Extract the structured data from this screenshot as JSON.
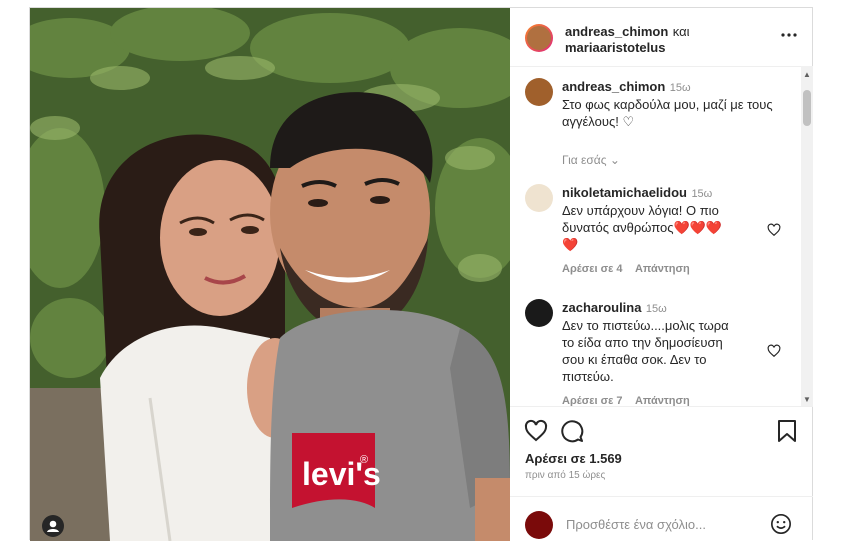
{
  "post": {
    "header": {
      "user1": "andreas_chimon",
      "and_word": "και",
      "user2": "mariaaristotelus"
    },
    "caption": {
      "user": "andreas_chimon",
      "time": "15ω",
      "text_line1": "Στο φως καρδούλα μου, μαζί με τους",
      "text_line2": "αγγέλους! ♡"
    },
    "for_you": "Για εσάς",
    "comments": [
      {
        "user": "nikoletamichaelidou",
        "time": "15ω",
        "line1": "Δεν υπάρχουν λόγια! Ο πιο",
        "line2": "δυνατός ανθρώπος❤️❤️❤️",
        "line3": "❤️",
        "likes": "Αρέσει σε 4",
        "reply": "Απάντηση"
      },
      {
        "user": "zacharoulina",
        "time": "15ω",
        "line1": "Δεν το πιστεύω....μολις τωρα",
        "line2": "το είδα απο την δημοσίευση",
        "line3": "σου κι έπαθα σοκ. Δεν το",
        "line4": "πιστεύω.",
        "likes": "Αρέσει σε 7",
        "reply": "Απάντηση"
      }
    ],
    "likes": "Αρέσει σε 1.569",
    "time_ago": "πριν από 15 ώρες",
    "add_comment_placeholder": "Προσθέστε ένα σχόλιο..."
  },
  "photo": {
    "tshirt_logo": "levi's",
    "tshirt_reg": "®"
  },
  "icons": [
    "more-icon",
    "heart-icon",
    "comment-icon",
    "bookmark-icon",
    "emoji-icon",
    "tag-user-icon",
    "chevron-down-icon"
  ],
  "colors": {
    "text": "#262626",
    "muted": "#8e8e8e",
    "border": "#dbdbdb",
    "levis_red": "#c41230"
  }
}
